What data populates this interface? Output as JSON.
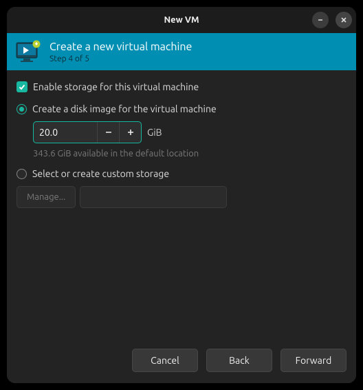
{
  "window": {
    "title": "New VM"
  },
  "banner": {
    "title": "Create a new virtual machine",
    "step": "Step 4 of 5"
  },
  "storage": {
    "enable_label": "Enable storage for this virtual machine",
    "create_disk_label": "Create a disk image for the virtual machine",
    "size_value": "20.0",
    "size_unit": "GiB",
    "available_hint": "343.6 GiB available in the default location",
    "custom_label": "Select or create custom storage",
    "manage_label": "Manage..."
  },
  "buttons": {
    "cancel": "Cancel",
    "back": "Back",
    "forward": "Forward"
  }
}
